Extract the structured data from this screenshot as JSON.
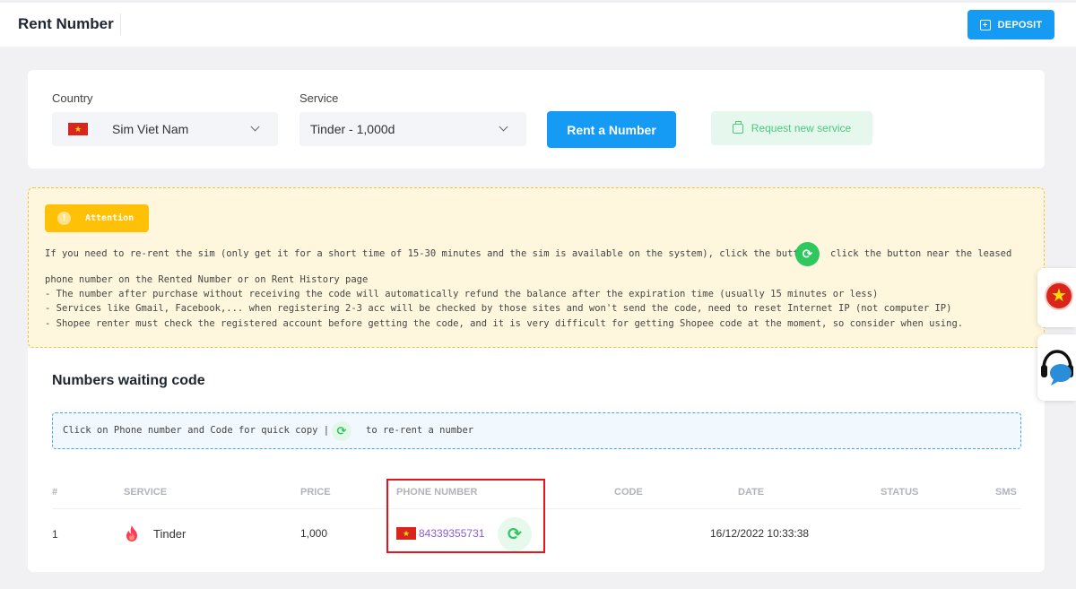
{
  "header": {
    "title": "Rent Number",
    "deposit_label": "DEPOSIT"
  },
  "form": {
    "country_label": "Country",
    "country_value": "Sim Viet Nam",
    "service_label": "Service",
    "service_value": "Tinder - 1,000d",
    "rent_button": "Rent a Number",
    "request_button": "Request new service"
  },
  "attention": {
    "badge": "Attention",
    "line1_a": "If you need to re-rent the sim (only get it for a short time of 15-30 minutes and the sim is available on the system), click the button",
    "line1_b": "click the button near the leased",
    "line2": "phone number on the Rented Number or on Rent History page",
    "line3": "- The number after purchase without receiving the code will automatically refund the balance after the expiration time (usually 15 minutes or less)",
    "line4": "- Services like Gmail, Facebook,... when registering 2-3 acc will be checked by those sites and won't send the code, need to reset Internet IP (not computer IP)",
    "line5": "- Shopee renter must check the registered account before getting the code, and it is very difficult for getting Shopee code at the moment, so consider when using."
  },
  "waiting": {
    "title": "Numbers waiting code",
    "hint_a": "Click on Phone number and Code for quick copy |",
    "hint_b": "to re-rent a number",
    "columns": [
      "#",
      "SERVICE",
      "PRICE",
      "PHONE NUMBER",
      "CODE",
      "DATE",
      "STATUS",
      "SMS"
    ],
    "rows": [
      {
        "index": "1",
        "service": "Tinder",
        "price": "1,000",
        "phone": "84339355731",
        "code": "",
        "date": "16/12/2022 10:33:38",
        "status": "",
        "sms": ""
      }
    ]
  },
  "colors": {
    "primary": "#159bf4",
    "success": "#2ec85f",
    "warning": "#ffc107",
    "highlight": "#e8141a"
  }
}
